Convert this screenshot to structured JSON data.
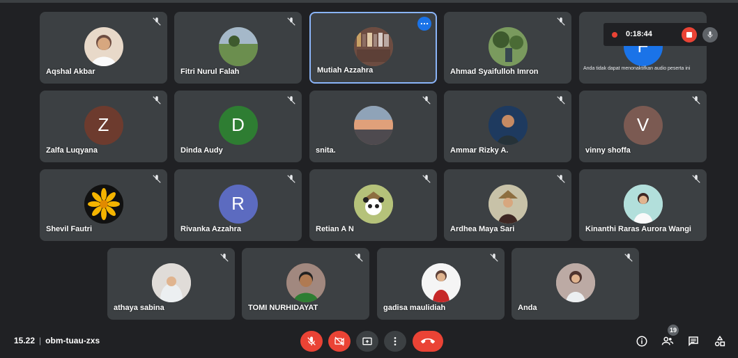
{
  "meeting": {
    "time": "15.22",
    "separator": "|",
    "code": "obm-tuau-zxs",
    "participant_count": "19"
  },
  "recording": {
    "elapsed": "0:18:44"
  },
  "notice": "Anda tidak dapat menonaktifkan audio peserta ini",
  "participants": [
    {
      "name": "Aqshal Akbar",
      "avatar": "photo",
      "color": "#e8d9c9"
    },
    {
      "name": "Fitri Nurul Falah",
      "avatar": "photo",
      "color": "#7c8c5e"
    },
    {
      "name": "Mutiah Azzahra",
      "avatar": "photo",
      "color": "#8a6b4a"
    },
    {
      "name": "Ahmad Syaifulloh Imron",
      "avatar": "photo",
      "color": "#5b7a4a"
    },
    {
      "name": "",
      "avatar": "letter",
      "letter": "F",
      "color": "#1a73e8"
    },
    {
      "name": "Zalfa Luqyana",
      "avatar": "letter",
      "letter": "Z",
      "color": "#6d3b2e"
    },
    {
      "name": "Dinda Audy",
      "avatar": "letter",
      "letter": "D",
      "color": "#2e7d32"
    },
    {
      "name": "snita.",
      "avatar": "photo",
      "color": "#b98a6a"
    },
    {
      "name": "Ammar Rizky A.",
      "avatar": "photo",
      "color": "#1e3a5f"
    },
    {
      "name": "vinny shoffa",
      "avatar": "letter",
      "letter": "V",
      "color": "#7b5a52"
    },
    {
      "name": "Shevil Fautri",
      "avatar": "photo",
      "color": "#f4b400"
    },
    {
      "name": "Rivanka Azzahra",
      "avatar": "letter",
      "letter": "R",
      "color": "#5c6bc0"
    },
    {
      "name": "Retian A N",
      "avatar": "photo",
      "color": "#b5c27a"
    },
    {
      "name": "Ardhea Maya Sari",
      "avatar": "photo",
      "color": "#9aa58a"
    },
    {
      "name": "Kinanthi Raras Aurora Wangi",
      "avatar": "photo",
      "color": "#cfd8dc"
    },
    {
      "name": "athaya sabina",
      "avatar": "photo",
      "color": "#e0dcd8"
    },
    {
      "name": "TOMI NURHIDAYAT",
      "avatar": "photo",
      "color": "#8d5a3c"
    },
    {
      "name": "gadisa maulidiah",
      "avatar": "photo",
      "color": "#c62828"
    },
    {
      "name": "Anda",
      "avatar": "photo",
      "color": "#d7ccc8"
    }
  ],
  "colors": {
    "background": "#202124",
    "tile": "#3c4043",
    "danger": "#ea4335",
    "active_border": "#8ab4f8"
  }
}
